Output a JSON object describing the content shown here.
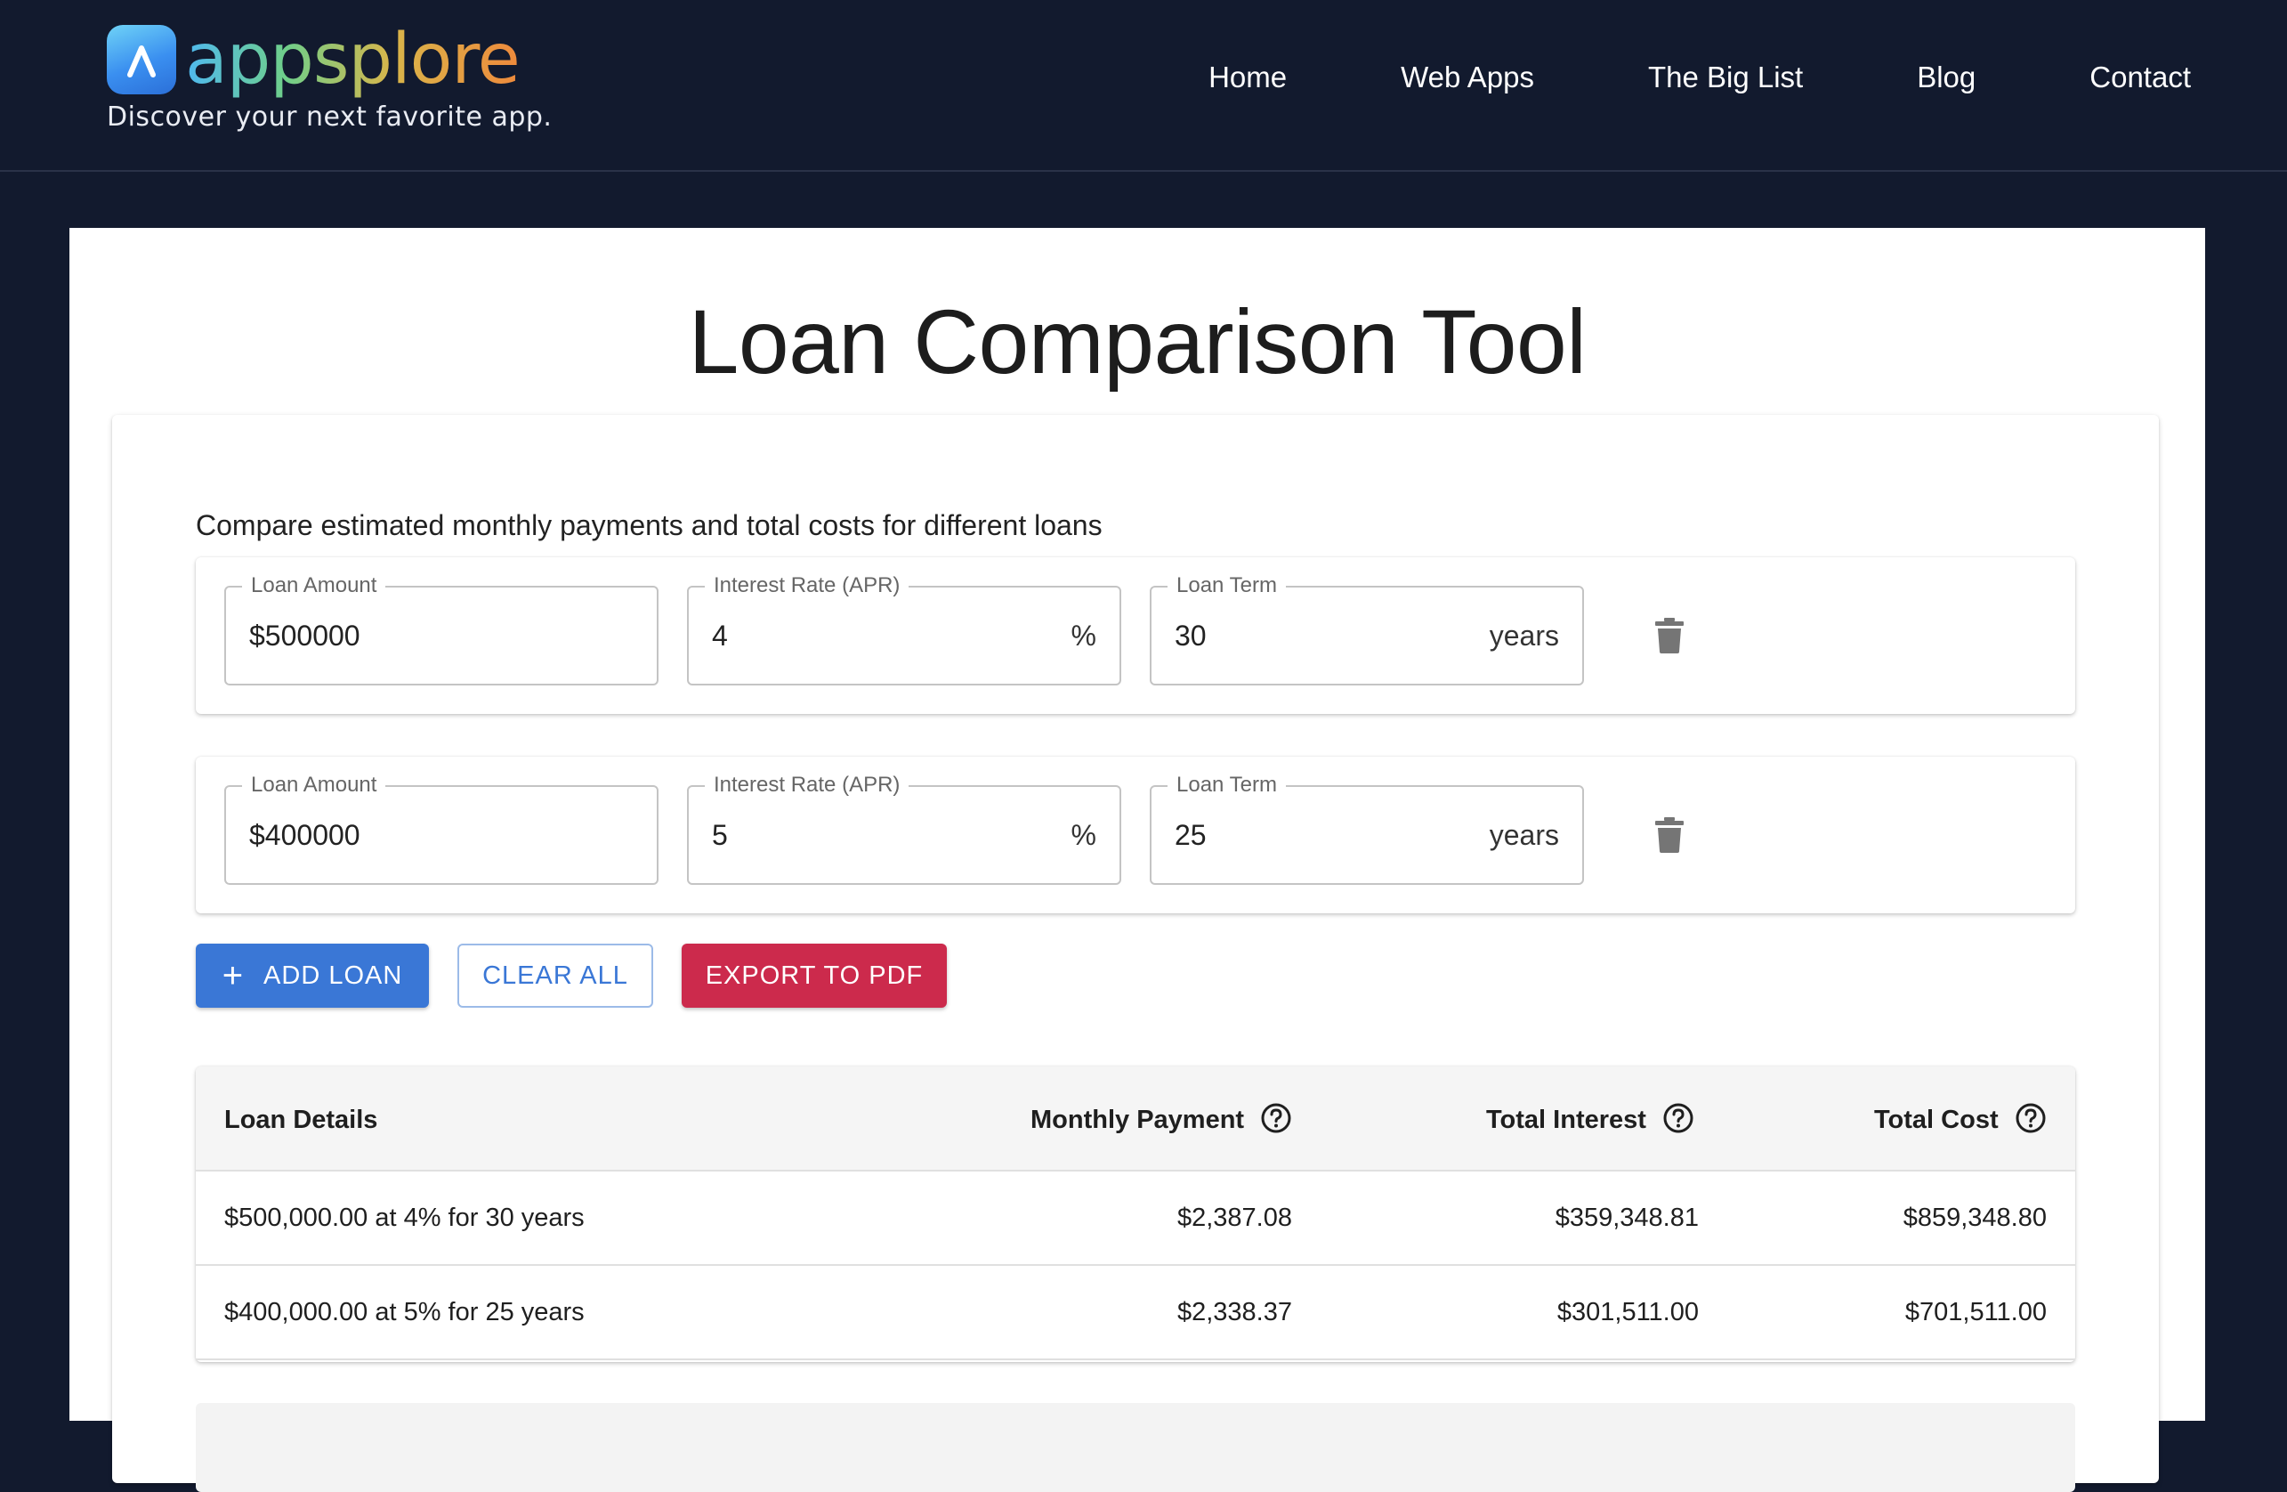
{
  "brand": {
    "name": "appsplore",
    "tagline": "Discover your next favorite app."
  },
  "nav": {
    "items": [
      {
        "label": "Home"
      },
      {
        "label": "Web Apps"
      },
      {
        "label": "The Big List"
      },
      {
        "label": "Blog"
      },
      {
        "label": "Contact"
      }
    ]
  },
  "page": {
    "title": "Loan Comparison Tool",
    "subtitle": "Compare estimated monthly payments and total costs for different loans"
  },
  "labels": {
    "amount": "Loan Amount",
    "rate": "Interest Rate (APR)",
    "term": "Loan Term",
    "rate_suffix": "%",
    "term_suffix": "years"
  },
  "loans": [
    {
      "amount": "$500000",
      "rate": "4",
      "term": "30"
    },
    {
      "amount": "$400000",
      "rate": "5",
      "term": "25"
    }
  ],
  "actions": {
    "add": "ADD LOAN",
    "clear": "CLEAR ALL",
    "export": "EXPORT TO PDF"
  },
  "table": {
    "headers": {
      "details": "Loan Details",
      "monthly": "Monthly Payment",
      "interest": "Total Interest",
      "cost": "Total Cost"
    },
    "rows": [
      {
        "details": "$500,000.00 at 4% for 30 years",
        "monthly": "$2,387.08",
        "interest": "$359,348.81",
        "cost": "$859,348.80"
      },
      {
        "details": "$400,000.00 at 5% for 25 years",
        "monthly": "$2,338.37",
        "interest": "$301,511.00",
        "cost": "$701,511.00"
      }
    ]
  },
  "colors": {
    "header_bg": "#121a2e",
    "primary": "#3a77d6",
    "danger": "#cc2a4c"
  },
  "icons": {
    "delete": "trash-icon",
    "help": "help-circle-icon",
    "add": "plus-icon"
  }
}
